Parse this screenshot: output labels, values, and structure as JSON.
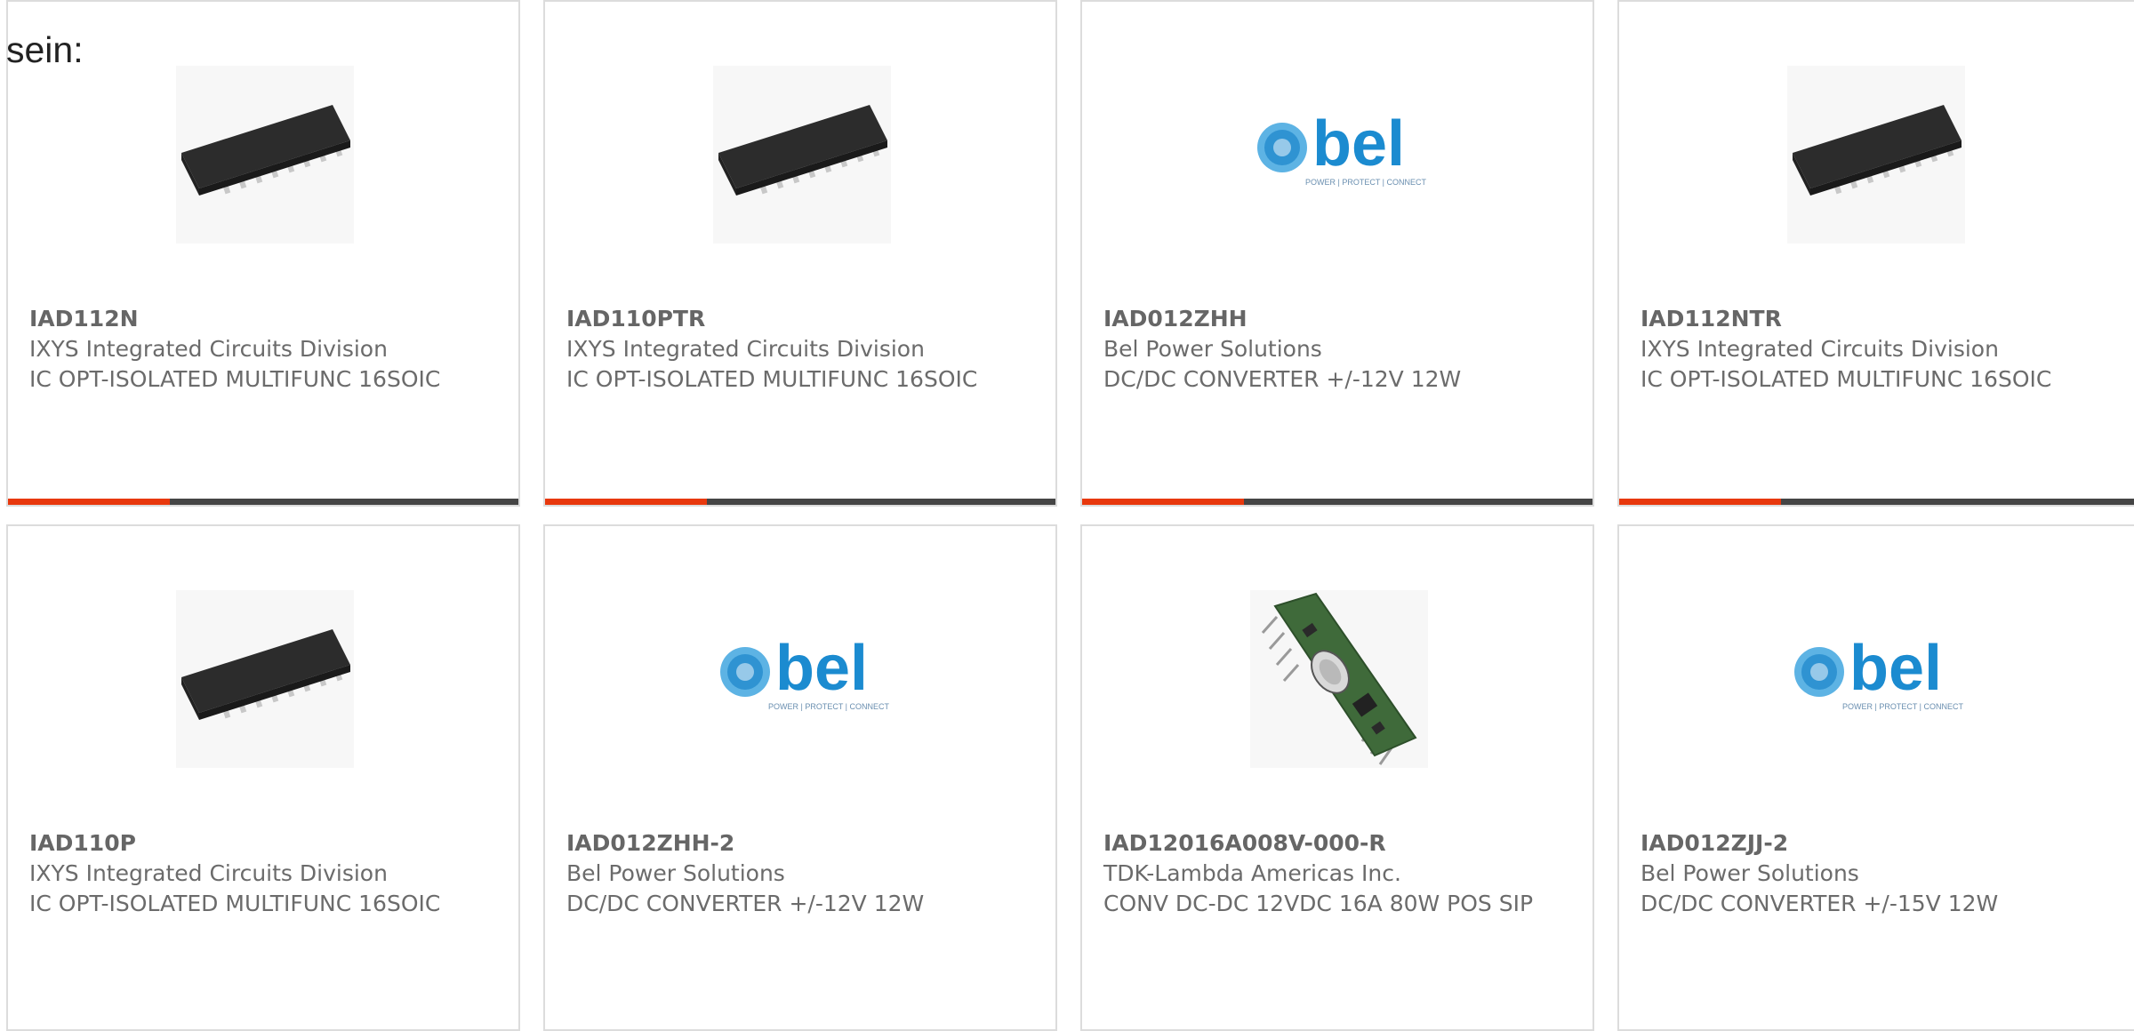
{
  "intro_text": "sein:",
  "colors": {
    "accent": "#e8380d",
    "bar": "#454545",
    "border": "#dcdcdc",
    "text": "#6b6b6b",
    "bel_blue": "#1b8bd0"
  },
  "products": [
    {
      "part": "IAD112N",
      "manufacturer": "IXYS Integrated Circuits Division",
      "description": "IC OPT-ISOLATED MULTIFUNC 16SOIC",
      "image": "soic-16-chip-icon"
    },
    {
      "part": "IAD110PTR",
      "manufacturer": "IXYS Integrated Circuits Division",
      "description": "IC OPT-ISOLATED MULTIFUNC 16SOIC",
      "image": "soic-16-chip-icon"
    },
    {
      "part": "IAD012ZHH",
      "manufacturer": "Bel Power Solutions",
      "description": "DC/DC CONVERTER +/-12V 12W",
      "image": "bel-logo",
      "logo_word": "bel",
      "logo_tagline": "POWER | PROTECT | CONNECT"
    },
    {
      "part": "IAD112NTR",
      "manufacturer": "IXYS Integrated Circuits Division",
      "description": "IC OPT-ISOLATED MULTIFUNC 16SOIC",
      "image": "soic-16-chip-icon"
    },
    {
      "part": "IAD110P",
      "manufacturer": "IXYS Integrated Circuits Division",
      "description": "IC OPT-ISOLATED MULTIFUNC 16SOIC",
      "image": "soic-16-chip-icon"
    },
    {
      "part": "IAD012ZHH-2",
      "manufacturer": "Bel Power Solutions",
      "description": "DC/DC CONVERTER +/-12V 12W",
      "image": "bel-logo",
      "logo_word": "bel",
      "logo_tagline": "POWER | PROTECT | CONNECT"
    },
    {
      "part": "IAD12016A008V-000-R",
      "manufacturer": "TDK-Lambda Americas Inc.",
      "description": "CONV DC-DC 12VDC 16A 80W POS SIP",
      "image": "sip-module-icon"
    },
    {
      "part": "IAD012ZJJ-2",
      "manufacturer": "Bel Power Solutions",
      "description": "DC/DC CONVERTER +/-15V 12W",
      "image": "bel-logo",
      "logo_word": "bel",
      "logo_tagline": "POWER | PROTECT | CONNECT"
    }
  ]
}
